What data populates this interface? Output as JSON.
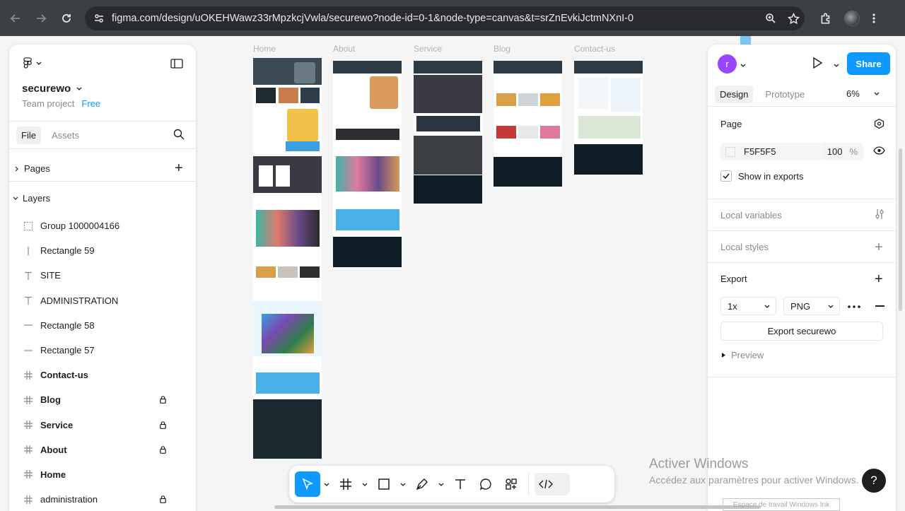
{
  "browser": {
    "url": "figma.com/design/uOKEHWawz33rMpzkcjVwla/securewo?node-id=0-1&node-type=canvas&t=srZnEvkiJctmNXnI-0"
  },
  "left_panel": {
    "file_name": "securewo",
    "team": "Team project",
    "plan": "Free",
    "tabs": [
      "File",
      "Assets"
    ],
    "pages_label": "Pages",
    "layers_label": "Layers",
    "layers": [
      {
        "name": "Group 1000004166",
        "icon": "group-icon",
        "bold": false,
        "locked": false
      },
      {
        "name": "Rectangle 59",
        "icon": "line-vertical-icon",
        "bold": false,
        "locked": false
      },
      {
        "name": "SITE",
        "icon": "text-icon",
        "bold": false,
        "locked": false
      },
      {
        "name": "ADMINISTRATION",
        "icon": "text-icon",
        "bold": false,
        "locked": false
      },
      {
        "name": "Rectangle 58",
        "icon": "line-icon",
        "bold": false,
        "locked": false
      },
      {
        "name": "Rectangle 57",
        "icon": "line-icon",
        "bold": false,
        "locked": false
      },
      {
        "name": "Contact-us",
        "icon": "frame-icon",
        "bold": true,
        "locked": false
      },
      {
        "name": "Blog",
        "icon": "frame-icon",
        "bold": true,
        "locked": true
      },
      {
        "name": "Service",
        "icon": "frame-icon",
        "bold": true,
        "locked": true
      },
      {
        "name": "About",
        "icon": "frame-icon",
        "bold": true,
        "locked": true
      },
      {
        "name": "Home",
        "icon": "frame-icon",
        "bold": true,
        "locked": false
      },
      {
        "name": "administration",
        "icon": "frame-icon",
        "bold": false,
        "locked": true
      }
    ]
  },
  "right_panel": {
    "user_initial": "r",
    "share_label": "Share",
    "tabs": [
      "Design",
      "Prototype"
    ],
    "zoom": "6%",
    "page_section": "Page",
    "bg_color": "F5F5F5",
    "bg_opacity": "100",
    "percent_sign": "%",
    "show_in_exports": "Show in exports",
    "local_variables": "Local variables",
    "local_styles": "Local styles",
    "export_section": "Export",
    "export_scale": "1x",
    "export_format": "PNG",
    "export_button": "Export securewo",
    "preview_label": "Preview"
  },
  "canvas": {
    "frames": [
      "Home",
      "About",
      "Service",
      "Blog",
      "Contact-us"
    ]
  },
  "watermark": {
    "title": "Activer Windows",
    "subtitle": "Accédez aux paramètres pour activer Windows.",
    "tooltip": "Espace de travail Windows Ink"
  },
  "help_label": "?",
  "colors": {
    "accent": "#0d99ff",
    "user": "#9747ff",
    "frame_dark": "#0f1d26"
  }
}
